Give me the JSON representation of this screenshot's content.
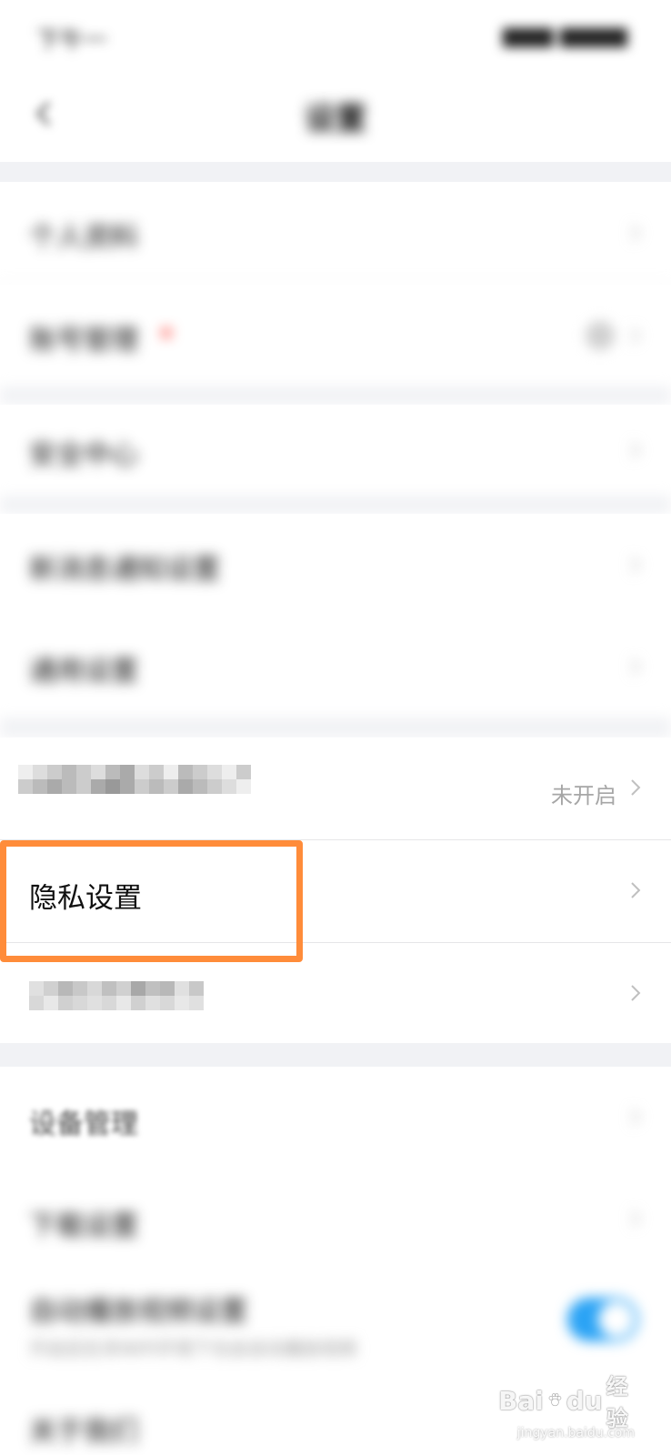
{
  "status_bar": {
    "time": "下午一",
    "right": "▆▆▆ ▆▆▆▆"
  },
  "nav": {
    "title": "设置"
  },
  "rows": {
    "row1": "个人资料",
    "row2": "账号管理",
    "row3": "安全中心",
    "row4": "新消息通知设置",
    "row5": "通用设置",
    "row6_status": "未开启",
    "privacy": "隐私设置",
    "device": "设备管理",
    "row10": "下载设置",
    "row11": "自动播放视频设置",
    "row11_sub": "开启后在非WiFi环境下也会自动播放视频",
    "row12": "关于我们"
  },
  "watermark": {
    "brand": "Bai",
    "brand2": "du",
    "suffix": "经验",
    "url": "jingyan.baidu.com"
  },
  "colors": {
    "highlight": "#ff8c3a",
    "toggle_on": "#2aa3f5",
    "gap_bg": "#f1f2f5"
  },
  "icons": {
    "back": "chevron-left-icon",
    "chevron": "chevron-right-icon",
    "toggle": "toggle-switch"
  }
}
